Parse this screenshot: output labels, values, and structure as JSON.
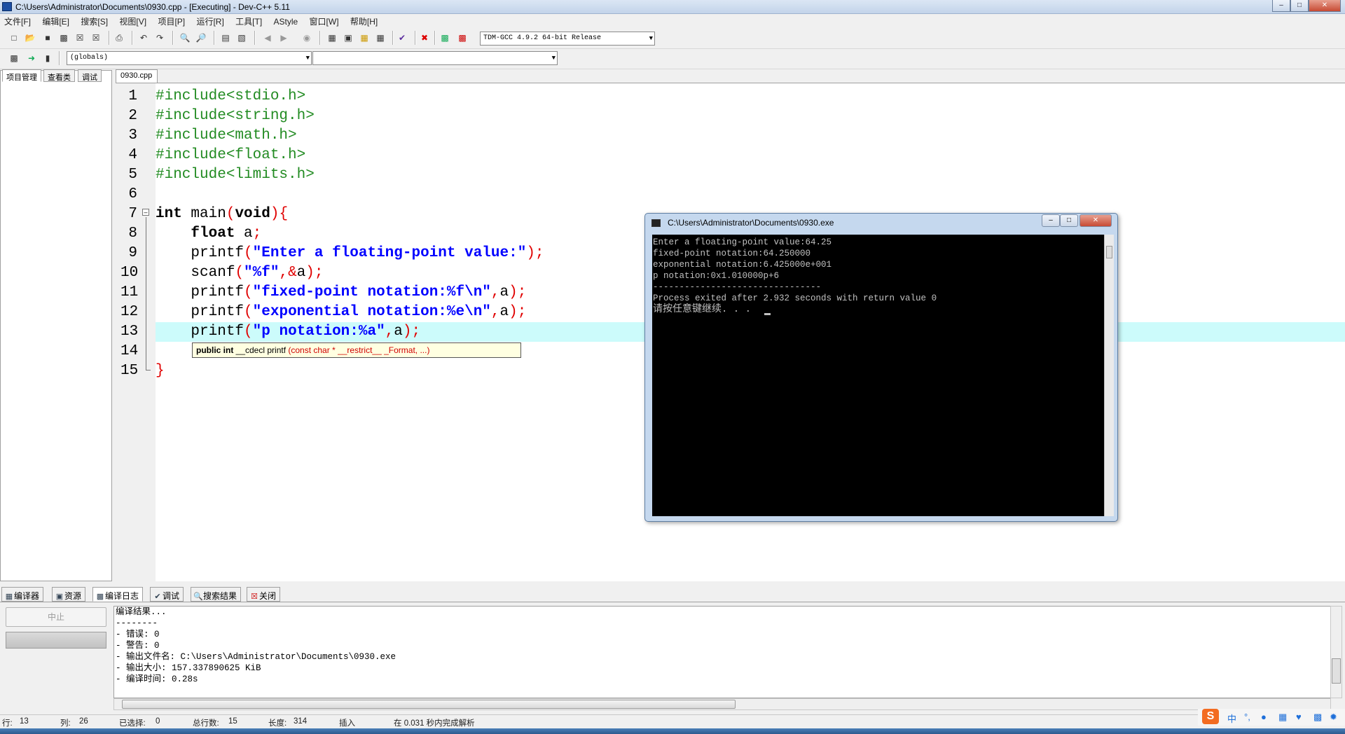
{
  "window": {
    "title": "C:\\Users\\Administrator\\Documents\\0930.cpp - [Executing] - Dev-C++ 5.11"
  },
  "menu": [
    "文件[F]",
    "编辑[E]",
    "搜索[S]",
    "视图[V]",
    "项目[P]",
    "运行[R]",
    "工具[T]",
    "AStyle",
    "窗口[W]",
    "帮助[H]"
  ],
  "toolbar": {
    "compiler": "TDM-GCC 4.9.2 64-bit Release",
    "scope": "(globals)",
    "member": ""
  },
  "left_tabs": [
    "项目管理",
    "查看类",
    "调试"
  ],
  "file_tab": "0930.cpp",
  "line_numbers": [
    "1",
    "2",
    "3",
    "4",
    "5",
    "6",
    "7",
    "8",
    "9",
    "10",
    "11",
    "12",
    "13",
    "14",
    "15"
  ],
  "code": {
    "l1": "#include<stdio.h>",
    "l2": "#include<string.h>",
    "l3": "#include<math.h>",
    "l4": "#include<float.h>",
    "l5": "#include<limits.h>",
    "l7_kw": "int",
    "l7_mid": " main",
    "l7_p1": "(",
    "l7_void": "void",
    "l7_p2": "){",
    "l8_kw": "float",
    "l8_id": " a",
    "l8_sc": ";",
    "l9_fn": "printf",
    "l9_p": "(",
    "l9_str": "\"Enter a floating-point value:\"",
    "l9_end": ");",
    "l10_fn": "scanf",
    "l10_p": "(",
    "l10_str": "\"%f\"",
    "l10_c": ",&",
    "l10_id": "a",
    "l10_end": ");",
    "l11_fn": "printf",
    "l11_p": "(",
    "l11_str": "\"fixed-point notation:%f\\n\"",
    "l11_c": ",",
    "l11_id": "a",
    "l11_end": ");",
    "l12_fn": "printf",
    "l12_p": "(",
    "l12_str": "\"exponential notation:%e\\n\"",
    "l12_c": ",",
    "l12_id": "a",
    "l12_end": ");",
    "l13_fn": "printf",
    "l13_p": "(",
    "l13_str": "\"p notation:%a\"",
    "l13_c": ",",
    "l13_id": "a",
    "l13_end": ");",
    "l14": "}",
    "l15": "}"
  },
  "tooltip": {
    "k1": "public int",
    "mid": " __cdecl printf ",
    "args": "(const char * __restrict__ _Format, ...)"
  },
  "console": {
    "title": "C:\\Users\\Administrator\\Documents\\0930.exe",
    "lines": [
      "Enter a floating-point value:64.25",
      "fixed-point notation:64.250000",
      "exponential notation:6.425000e+001",
      "p notation:0x1.010000p+6",
      "--------------------------------",
      "Process exited after 2.932 seconds with return value 0",
      "请按任意键继续. . ."
    ]
  },
  "bottom_tabs": [
    "编译器",
    "资源",
    "编译日志",
    "调试",
    "搜索结果",
    "关闭"
  ],
  "stop_button": "中止",
  "log": [
    "编译结果...",
    "--------",
    "- 错误: 0",
    "- 警告: 0",
    "- 输出文件名: C:\\Users\\Administrator\\Documents\\0930.exe",
    "- 输出大小: 157.337890625 KiB",
    "- 编译时间: 0.28s"
  ],
  "status": {
    "row_label": "行:",
    "row": "13",
    "col_label": "列:",
    "col": "26",
    "sel_label": "已选择:",
    "sel": "0",
    "total_label": "总行数:",
    "total": "15",
    "len_label": "长度:",
    "len": "314",
    "mode": "插入",
    "parse": "在 0.031 秒内完成解析"
  },
  "ime": {
    "lang": "中"
  }
}
